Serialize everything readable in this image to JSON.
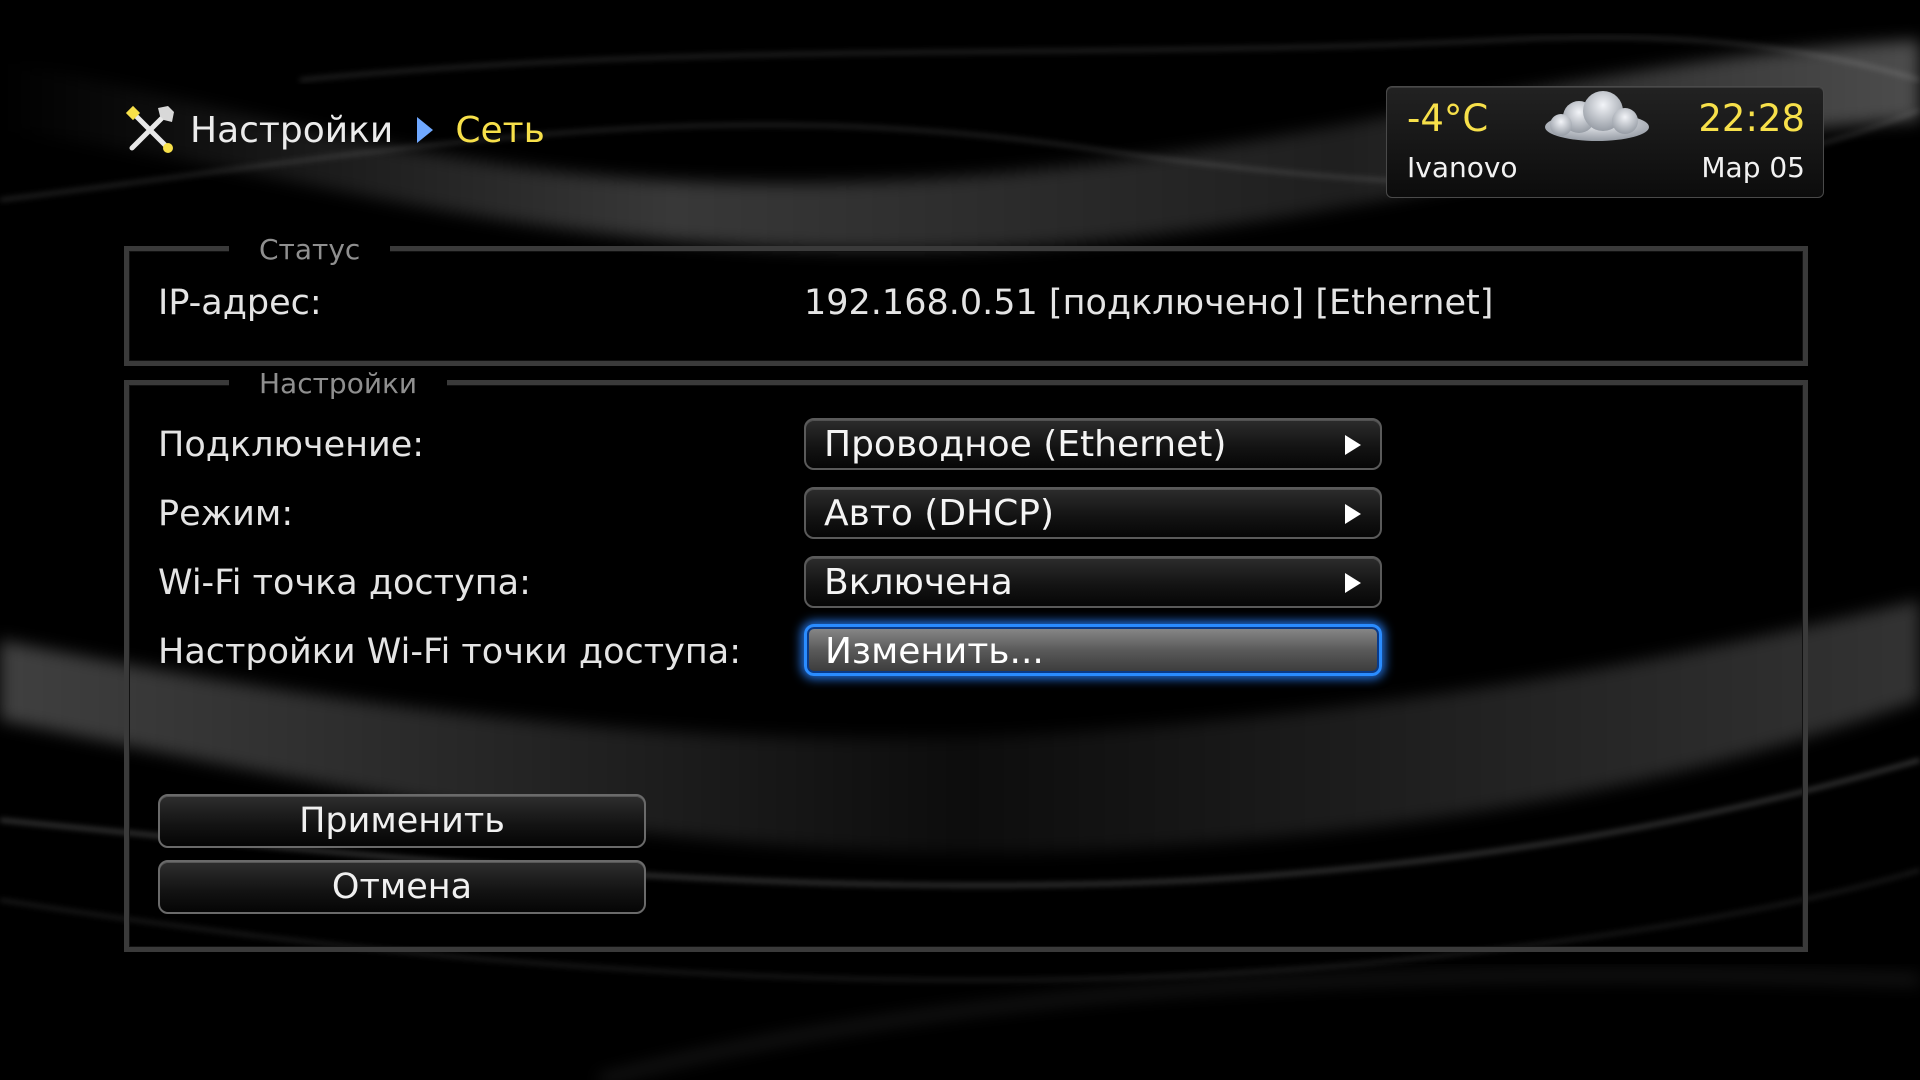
{
  "header": {
    "root_icon": "tools-icon",
    "root_label": "Настройки",
    "separator_icon": "chevron-right-icon",
    "current_label": "Сеть"
  },
  "weather": {
    "temperature": "-4°C",
    "condition_icon": "cloud-icon",
    "time": "22:28",
    "city": "Ivanovo",
    "date": "Мар 05"
  },
  "status": {
    "legend": "Статус",
    "ip_label": "IP-адрес:",
    "ip_value": "192.168.0.51 [подключено] [Ethernet]"
  },
  "settings": {
    "legend": "Настройки",
    "rows": [
      {
        "label": "Подключение:",
        "value": "Проводное (Ethernet)",
        "has_arrow": true,
        "focused": false
      },
      {
        "label": "Режим:",
        "value": "Авто (DHCP)",
        "has_arrow": true,
        "focused": false
      },
      {
        "label": "Wi-Fi точка доступа:",
        "value": "Включена",
        "has_arrow": true,
        "focused": false
      },
      {
        "label": "Настройки Wi-Fi точки доступа:",
        "value": "Изменить...",
        "has_arrow": false,
        "focused": true
      }
    ],
    "apply_label": "Применить",
    "cancel_label": "Отмена"
  },
  "colors": {
    "accent_yellow": "#f7e04a",
    "focus_blue": "#2a8cff",
    "background": "#000000",
    "text": "#e8e8e8",
    "legend_text": "#8f8f8f"
  }
}
